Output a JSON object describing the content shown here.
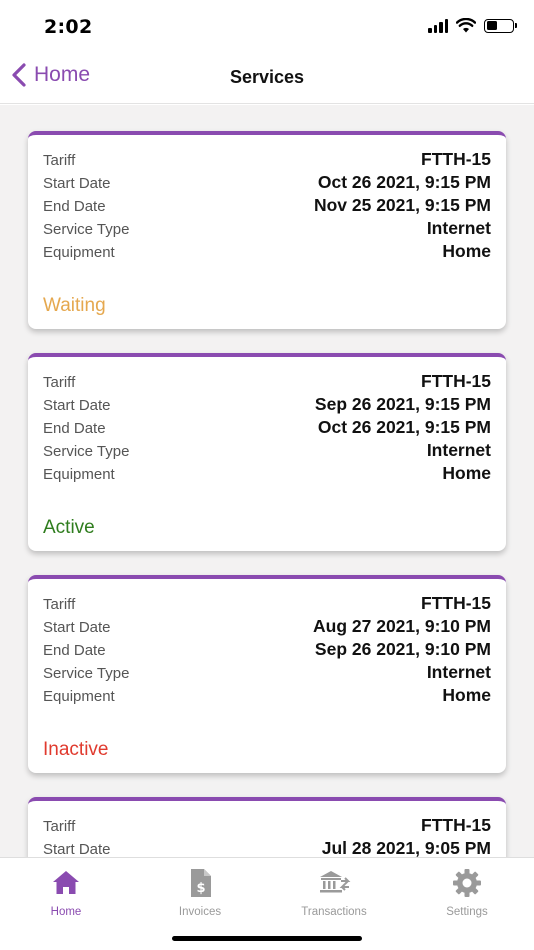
{
  "status_bar": {
    "time": "2:02"
  },
  "nav": {
    "back_label": "Home",
    "title": "Services"
  },
  "labels": {
    "tariff": "Tariff",
    "start_date": "Start Date",
    "end_date": "End Date",
    "service_type": "Service Type",
    "equipment": "Equipment"
  },
  "services": [
    {
      "tariff": "FTTH-15",
      "start_date": "Oct 26 2021, 9:15 PM",
      "end_date": "Nov 25 2021, 9:15 PM",
      "service_type": "Internet",
      "equipment": "Home",
      "status": "Waiting",
      "status_color": "#e5a84f"
    },
    {
      "tariff": "FTTH-15",
      "start_date": "Sep 26 2021, 9:15 PM",
      "end_date": "Oct 26 2021, 9:15 PM",
      "service_type": "Internet",
      "equipment": "Home",
      "status": "Active",
      "status_color": "#2f7d1e"
    },
    {
      "tariff": "FTTH-15",
      "start_date": "Aug 27 2021, 9:10 PM",
      "end_date": "Sep 26 2021, 9:10 PM",
      "service_type": "Internet",
      "equipment": "Home",
      "status": "Inactive",
      "status_color": "#e03a2e"
    },
    {
      "tariff": "FTTH-15",
      "start_date": "Jul 28 2021, 9:05 PM"
    }
  ],
  "tabs": [
    {
      "label": "Home",
      "icon": "home-icon",
      "active": true
    },
    {
      "label": "Invoices",
      "icon": "invoice-icon",
      "active": false
    },
    {
      "label": "Transactions",
      "icon": "bank-transfer-icon",
      "active": false
    },
    {
      "label": "Settings",
      "icon": "gear-icon",
      "active": false
    }
  ],
  "colors": {
    "accent": "#8a4bb0",
    "tab_inactive": "#9a9a9a",
    "background": "#f3f2f2"
  }
}
